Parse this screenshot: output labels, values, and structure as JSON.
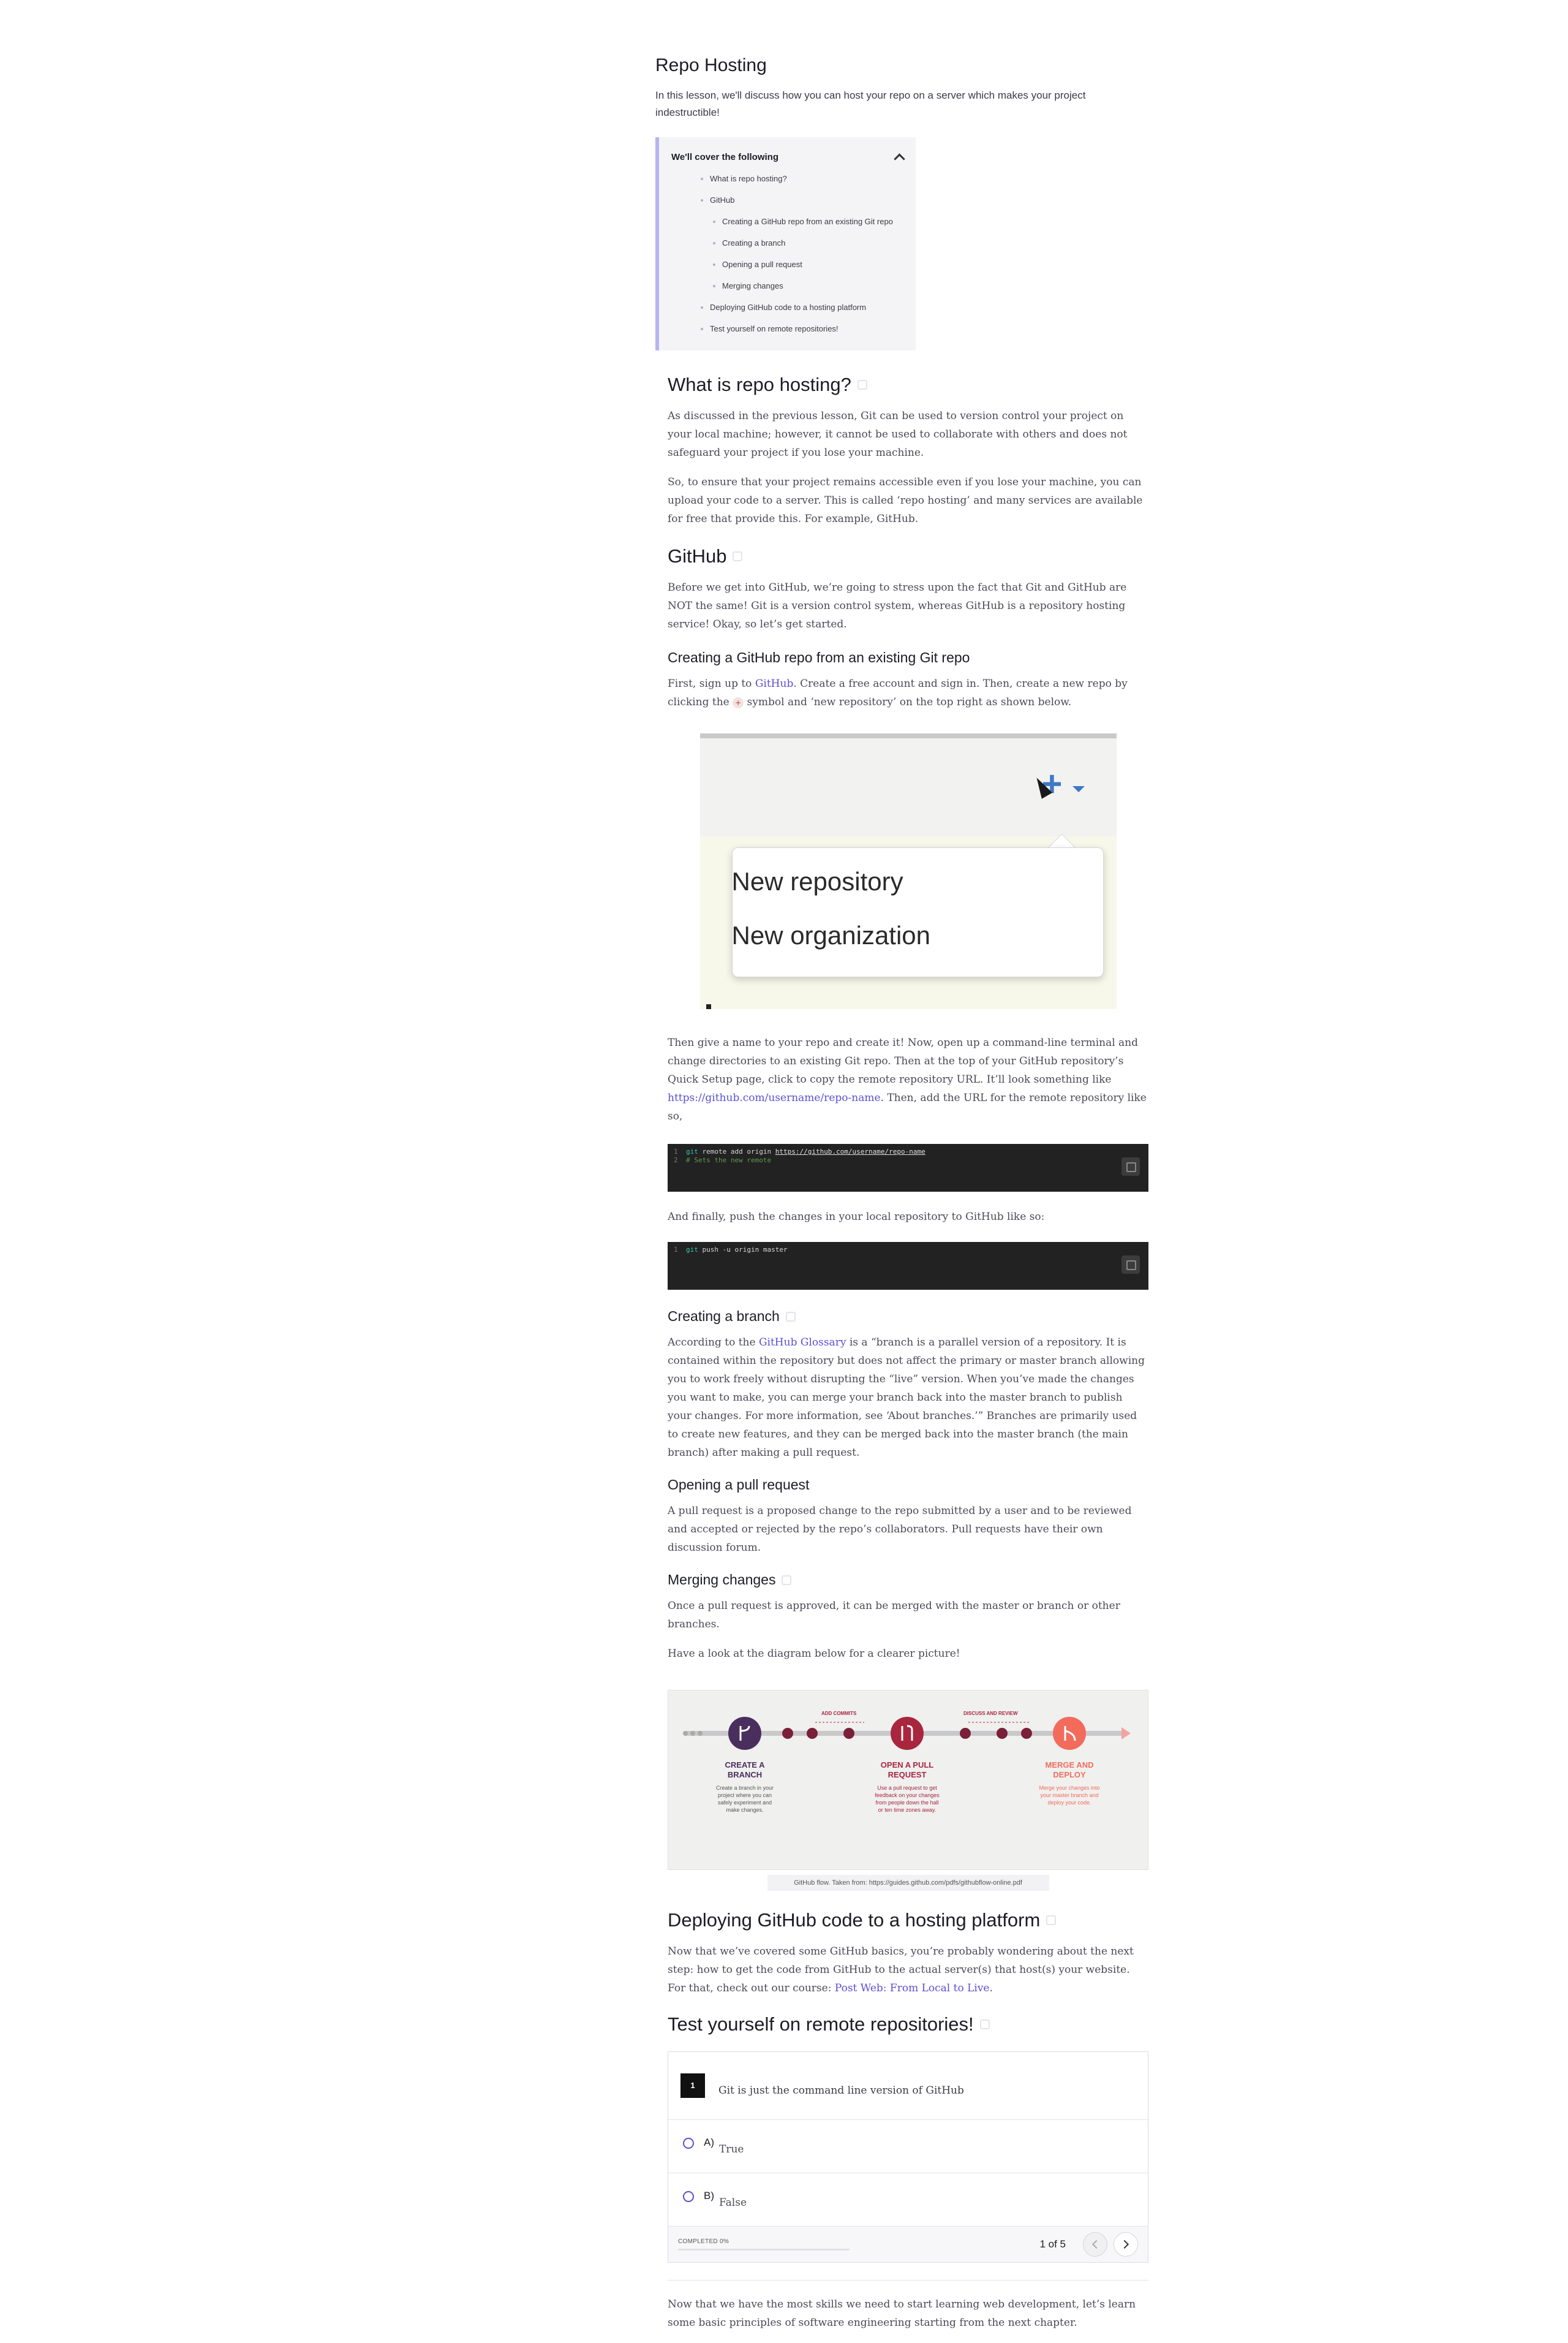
{
  "lesson": {
    "title": "Repo Hosting",
    "intro": "In this lesson, we'll discuss how you can host your repo on a server which makes your project indestructible!"
  },
  "toc": {
    "heading": "We'll cover the following",
    "items": [
      {
        "label": "What is repo hosting?",
        "level": 1
      },
      {
        "label": "GitHub",
        "level": 1
      },
      {
        "label": "Creating a GitHub repo from an existing Git repo",
        "level": 2
      },
      {
        "label": "Creating a branch",
        "level": 2
      },
      {
        "label": "Opening a pull request",
        "level": 2
      },
      {
        "label": "Merging changes",
        "level": 2
      },
      {
        "label": "Deploying GitHub code to a hosting platform",
        "level": 1
      },
      {
        "label": "Test yourself on remote repositories!",
        "level": 1
      }
    ]
  },
  "sections": {
    "what": {
      "heading": "What is repo hosting?",
      "p1": "As discussed in the previous lesson, Git can be used to version control your project on your local machine; however, it cannot be used to collaborate with others and does not safeguard your project if you lose your machine.",
      "p2": "So, to ensure that your project remains accessible even if you lose your machine, you can upload your code to a server. This is called ‘repo hosting’ and many services are available for free that provide this. For example, GitHub."
    },
    "github": {
      "heading": "GitHub",
      "p1": "Before we get into GitHub, we’re going to stress upon the fact that Git and GitHub are NOT the same! Git is a version control system, whereas GitHub is a repository hosting service! Okay, so let’s get started."
    },
    "create_repo": {
      "heading": "Creating a GitHub repo from an existing Git repo",
      "p1_a": "First, sign up to ",
      "p1_link": "GitHub",
      "p1_b": ". Create a free account and sign in. Then, create a new repo by clicking the ",
      "p1_symbol": "+",
      "p1_c": " symbol and ‘new repository’ on the top right as shown below.",
      "screenshot": {
        "menu_item_1": "New repository",
        "menu_item_2": "New organization"
      },
      "p2_a": "Then give a name to your repo and create it! Now, open up a command-line terminal and change directories to an existing Git repo. Then at the top of your GitHub repository’s Quick Setup page, click to copy the remote repository URL. It’ll look something like ",
      "p2_link": "https://github.com/username/repo-name",
      "p2_b": ". Then, add the URL for the remote repository like so,",
      "code1": {
        "ln1": "1",
        "kw1": "git",
        "cmd1": " remote add origin ",
        "url1": "https://github.com/username/repo-name",
        "ln2": "2",
        "comment": "# Sets the new remote"
      },
      "p3": "And finally, push the changes in your local repository to GitHub like so:",
      "code2": {
        "ln1": "1",
        "kw1": "git",
        "cmd1": " push -u origin master"
      }
    },
    "branch": {
      "heading": "Creating a branch",
      "p1_a": "According to the ",
      "p1_link": "GitHub Glossary",
      "p1_b": " is a “branch is a parallel version of a repository. It is contained within the repository but does not affect the primary or master branch allowing you to work freely without disrupting the “live” version. When you’ve made the changes you want to make, you can merge your branch back into the master branch to publish your changes. For more information, see ‘About branches.’” Branches are primarily used to create new features, and they can be merged back into the master branch (the main branch) after making a pull request."
    },
    "pull": {
      "heading": "Opening a pull request",
      "p1": "A pull request is a proposed change to the repo submitted by a user and to be reviewed and accepted or rejected by the repo’s collaborators. Pull requests have their own discussion forum."
    },
    "merge": {
      "heading": "Merging changes",
      "p1": "Once a pull request is approved, it can be merged with the master or branch or other branches.",
      "p2": "Have a look at the diagram below for a clearer picture!"
    },
    "flow": {
      "add_commits": "ADD COMMITS",
      "discuss_review": "DISCUSS AND REVIEW",
      "step1_title_a": "CREATE A",
      "step1_title_b": "BRANCH",
      "step1_desc": [
        "Create a branch in your",
        "project where you can",
        "safely experiment and",
        "make changes."
      ],
      "step2_title_a": "OPEN A PULL",
      "step2_title_b": "REQUEST",
      "step2_desc": [
        "Use a pull request to get",
        "feedback on your changes",
        "from people down the hall",
        "or ten time zones away."
      ],
      "step3_title_a": "MERGE AND",
      "step3_title_b": "DEPLOY",
      "step3_desc": [
        "Merge your changes into",
        "your master branch and",
        "deploy your code."
      ],
      "caption": "GitHub flow. Taken from: https://guides.github.com/pdfs/githubflow-online.pdf",
      "colors": {
        "step1": "#4a2f5e",
        "step2": "#a8263e",
        "step3": "#f26b5b",
        "line": "#c9c9cc"
      }
    },
    "deploy": {
      "heading": "Deploying GitHub code to a hosting platform",
      "p1_a": "Now that we’ve covered some GitHub basics, you’re probably wondering about the next step: how to get the code from GitHub to the actual server(s) that host(s) your website. For that, check out our course: ",
      "p1_link": "Post Web: From Local to Live",
      "p1_b": "."
    },
    "quiz": {
      "heading": "Test yourself on remote repositories!",
      "number": "1",
      "question": "Git is just the command line version of GitHub",
      "options": [
        {
          "letter": "A)",
          "text": "True"
        },
        {
          "letter": "B)",
          "text": "False"
        }
      ],
      "progress_label": "COMPLETED 0%",
      "progress": 0,
      "pager": "1 of 5"
    },
    "closing": "Now that we have the most skills we need to start learning web development, let’s learn some basic principles of software engineering starting from the next chapter."
  },
  "colors": {
    "accent": "#5a4fd6",
    "toc_border": "#b8b3f0",
    "code_bg": "#222222"
  }
}
